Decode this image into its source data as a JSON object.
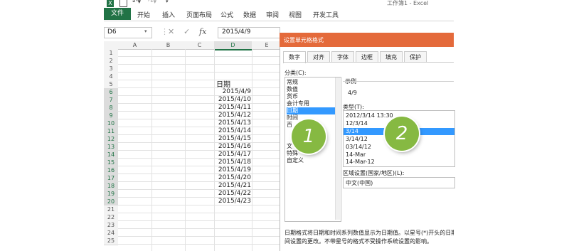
{
  "window": {
    "title": "工作簿1 - Excel"
  },
  "quick_access": {
    "excel_icon": "excel-logo-icon",
    "save_icon": "save-icon",
    "undo_icon": "undo-icon",
    "redo_icon": "redo-icon",
    "customize_icon": "customize-icon"
  },
  "ribbon": {
    "file_tab": "文件",
    "tabs": [
      "开始",
      "插入",
      "页面布局",
      "公式",
      "数据",
      "审阅",
      "视图",
      "开发工具"
    ],
    "accent_color": "#217346"
  },
  "formula_bar": {
    "name_box": "D6",
    "cancel_icon": "close-icon",
    "enter_icon": "check-icon",
    "fx_label": "fx",
    "value": "2015/4/9"
  },
  "sheet": {
    "columns": [
      "A",
      "B",
      "C",
      "D",
      "E"
    ],
    "rows": [
      "1",
      "2",
      "3",
      "4",
      "5",
      "6",
      "7",
      "8",
      "9",
      "10",
      "11",
      "12",
      "13",
      "14",
      "15",
      "16",
      "17",
      "18",
      "19",
      "20",
      "21",
      "22",
      "23",
      "24",
      "25"
    ],
    "header_cell": "日期",
    "dates": [
      "2015/4/9",
      "2015/4/10",
      "2015/4/11",
      "2015/4/12",
      "2015/4/13",
      "2015/4/14",
      "2015/4/15",
      "2015/4/16",
      "2015/4/17",
      "2015/4/18",
      "2015/4/19",
      "2015/4/20",
      "2015/4/21",
      "2015/4/22",
      "2015/4/23"
    ]
  },
  "dialog": {
    "title": "设置单元格格式",
    "title_color": "#e46a3b",
    "tabs": [
      "数字",
      "对齐",
      "字体",
      "边框",
      "填充",
      "保护"
    ],
    "category_label": "分类(C):",
    "categories": [
      "常规",
      "数值",
      "货币",
      "会计专用",
      "日期",
      "时间",
      "百",
      "",
      "",
      "文",
      "特殊",
      "自定义"
    ],
    "selected_category": "日期",
    "sample_label": "示例",
    "sample_value": "4/9",
    "type_label": "类型(T):",
    "types": [
      "2012/3/14 13:30",
      "12/3/14",
      "3/14",
      "3/14/12",
      "03/14/12",
      "14-Mar",
      "14-Mar-12"
    ],
    "selected_type": "3/14",
    "locale_label": "区域设置(国家/地区)(L):",
    "locale_value": "中文(中国)",
    "description_line1": "日期格式将日期和时间系列数值显示为日期值。以星号(*)开头的日期格式",
    "description_line2": "间设置的更改。不带星号的格式不受操作系统设置的影响。"
  },
  "callouts": {
    "first": "1",
    "second": "2",
    "color": "#86b942"
  }
}
